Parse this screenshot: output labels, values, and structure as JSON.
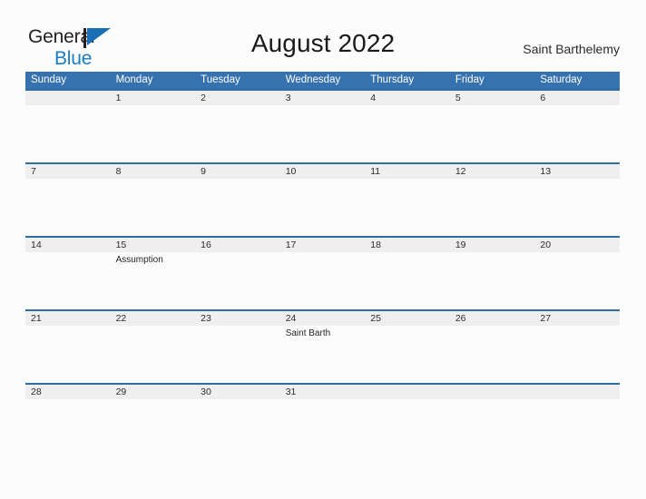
{
  "brand": {
    "name_part1": "General",
    "name_part2": "Blue",
    "flag_icon": "blue-triangle-flag",
    "color_dark": "#231f20",
    "color_blue": "#1a7cc1"
  },
  "header": {
    "title": "August 2022",
    "location": "Saint Barthelemy"
  },
  "theme": {
    "header_blue": "#3672b0",
    "row_border_blue": "#2e6da4",
    "day_band_gray": "#efefef",
    "page_background": "#fcfcfd"
  },
  "calendar": {
    "weekday_headers": [
      "Sunday",
      "Monday",
      "Tuesday",
      "Wednesday",
      "Thursday",
      "Friday",
      "Saturday"
    ],
    "weeks": [
      [
        {
          "date": "",
          "events": []
        },
        {
          "date": "1",
          "events": []
        },
        {
          "date": "2",
          "events": []
        },
        {
          "date": "3",
          "events": []
        },
        {
          "date": "4",
          "events": []
        },
        {
          "date": "5",
          "events": []
        },
        {
          "date": "6",
          "events": []
        }
      ],
      [
        {
          "date": "7",
          "events": []
        },
        {
          "date": "8",
          "events": []
        },
        {
          "date": "9",
          "events": []
        },
        {
          "date": "10",
          "events": []
        },
        {
          "date": "11",
          "events": []
        },
        {
          "date": "12",
          "events": []
        },
        {
          "date": "13",
          "events": []
        }
      ],
      [
        {
          "date": "14",
          "events": []
        },
        {
          "date": "15",
          "events": [
            "Assumption"
          ]
        },
        {
          "date": "16",
          "events": []
        },
        {
          "date": "17",
          "events": []
        },
        {
          "date": "18",
          "events": []
        },
        {
          "date": "19",
          "events": []
        },
        {
          "date": "20",
          "events": []
        }
      ],
      [
        {
          "date": "21",
          "events": []
        },
        {
          "date": "22",
          "events": []
        },
        {
          "date": "23",
          "events": []
        },
        {
          "date": "24",
          "events": [
            "Saint Barth"
          ]
        },
        {
          "date": "25",
          "events": []
        },
        {
          "date": "26",
          "events": []
        },
        {
          "date": "27",
          "events": []
        }
      ],
      [
        {
          "date": "28",
          "events": []
        },
        {
          "date": "29",
          "events": []
        },
        {
          "date": "30",
          "events": []
        },
        {
          "date": "31",
          "events": []
        },
        {
          "date": "",
          "events": []
        },
        {
          "date": "",
          "events": []
        },
        {
          "date": "",
          "events": []
        }
      ]
    ]
  }
}
